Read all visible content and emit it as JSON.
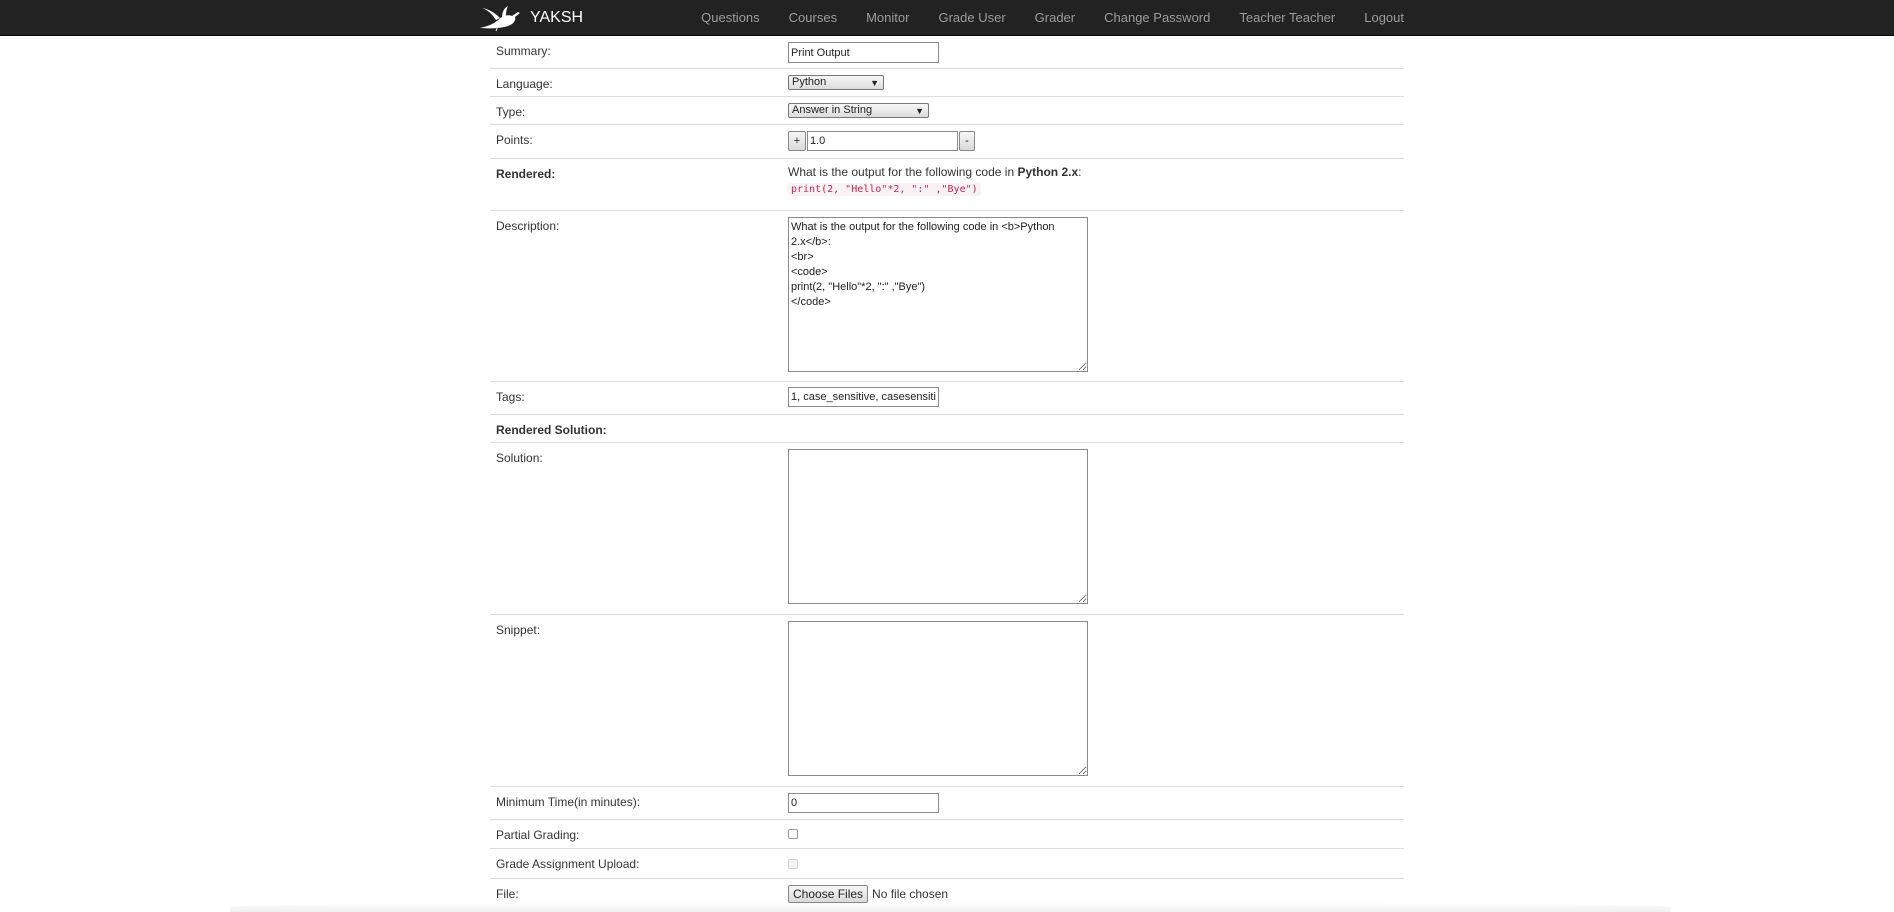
{
  "nav": {
    "brand": "YAKSH",
    "links": [
      "Questions",
      "Courses",
      "Monitor",
      "Grade User",
      "Grader",
      "Change Password",
      "Teacher Teacher",
      "Logout"
    ]
  },
  "form": {
    "summary": {
      "label": "Summary:",
      "value": "Print Output"
    },
    "language": {
      "label": "Language:",
      "selected": "Python"
    },
    "type": {
      "label": "Type:",
      "selected": "Answer in String"
    },
    "points": {
      "label": "Points:",
      "value": "1.0",
      "plus": "+",
      "minus": "-"
    },
    "rendered": {
      "label": "Rendered:",
      "text_before": "What is the output for the following code in ",
      "bold": "Python 2.x",
      "text_after": ":",
      "code": "print(2, \"Hello\"*2, \":\" ,\"Bye\")"
    },
    "description": {
      "label": "Description:",
      "value": "What is the output for the following code in <b>Python 2.x</b>:\n<br>\n<code>\nprint(2, \"Hello\"*2, \":\" ,\"Bye\")\n</code>"
    },
    "tags": {
      "label": "Tags:",
      "value": "1, case_sensitive, casesensiti"
    },
    "rendered_solution": {
      "label": "Rendered Solution:"
    },
    "solution": {
      "label": "Solution:",
      "value": ""
    },
    "snippet": {
      "label": "Snippet:",
      "value": ""
    },
    "min_time": {
      "label": "Minimum Time(in minutes):",
      "value": "0"
    },
    "partial_grading": {
      "label": "Partial Grading:"
    },
    "grade_assignment": {
      "label": "Grade Assignment Upload:"
    },
    "file": {
      "label": "File:",
      "button": "Choose Files",
      "status": "No file chosen"
    }
  }
}
